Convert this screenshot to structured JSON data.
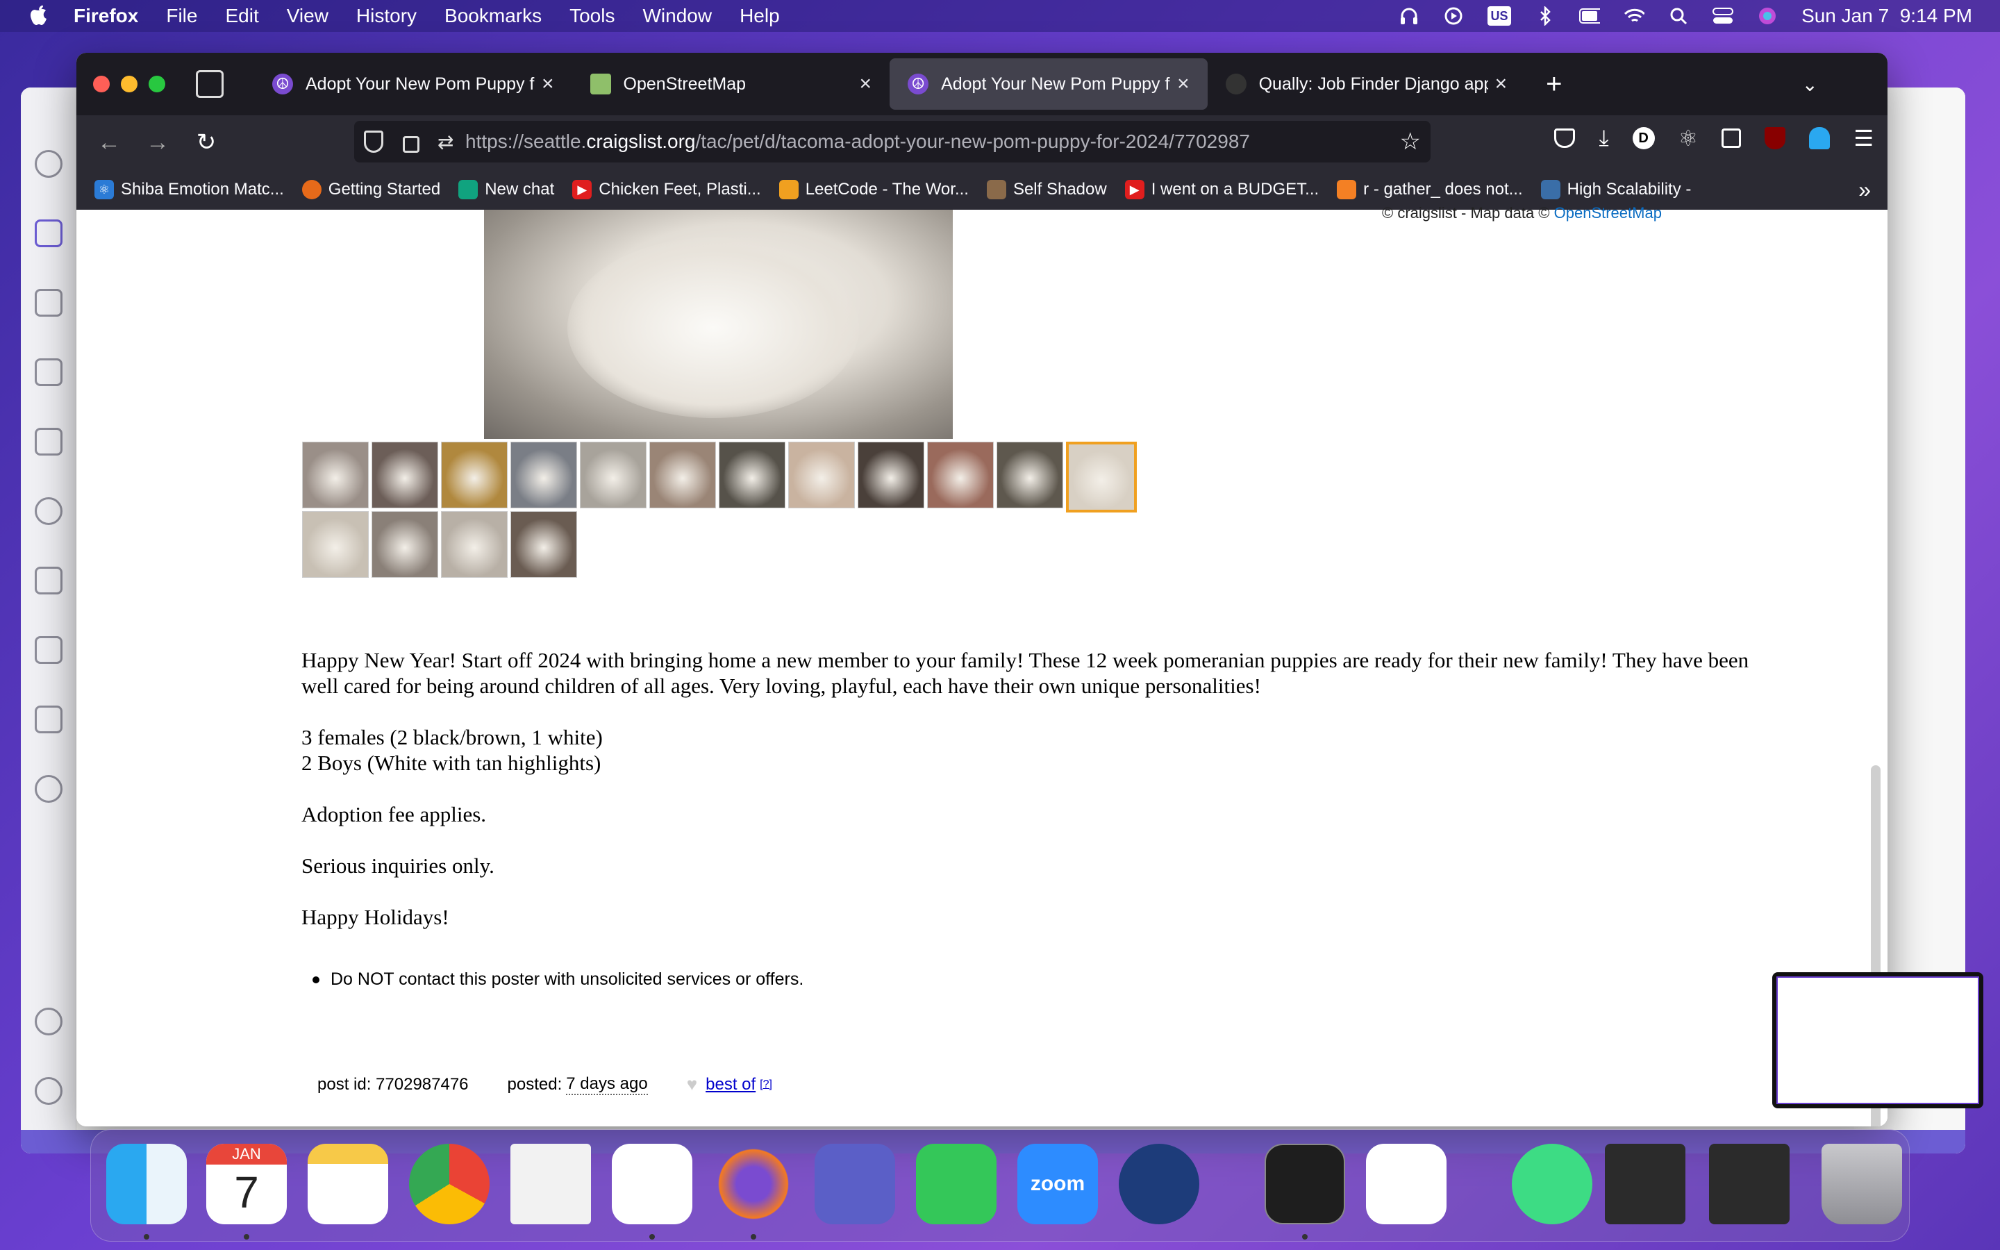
{
  "menubar": {
    "app": "Firefox",
    "items": [
      "File",
      "Edit",
      "View",
      "History",
      "Bookmarks",
      "Tools",
      "Window",
      "Help"
    ],
    "input_source": "US",
    "datetime": "Sun Jan 7  9:14 PM"
  },
  "firefox": {
    "tabs": [
      {
        "title": "Adopt Your New Pom Puppy for",
        "icon": "peace-icon"
      },
      {
        "title": "OpenStreetMap",
        "icon": "map-icon"
      },
      {
        "title": "Adopt Your New Pom Puppy for",
        "icon": "peace-icon",
        "active": true
      },
      {
        "title": "Qually: Job Finder Django app |",
        "icon": "github-icon"
      }
    ],
    "url_prefix": "https://seattle.",
    "url_domain": "craigslist.org",
    "url_path": "/tac/pet/d/tacoma-adopt-your-new-pom-puppy-for-2024/7702987",
    "bookmarks": [
      {
        "label": "Shiba Emotion Matc...",
        "color": "#2b7bd6"
      },
      {
        "label": "Getting Started",
        "color": "#e66a1a"
      },
      {
        "label": "New chat",
        "color": "#10a37f"
      },
      {
        "label": "Chicken Feet, Plasti...",
        "color": "#e01e1e"
      },
      {
        "label": "LeetCode - The Wor...",
        "color": "#f0a020"
      },
      {
        "label": "Self Shadow",
        "color": "#8a6a4a"
      },
      {
        "label": "I went on a BUDGET...",
        "color": "#e01e1e"
      },
      {
        "label": "r - gather_ does not...",
        "color": "#f48024"
      },
      {
        "label": "High Scalability -",
        "color": "#3a6ea8"
      }
    ]
  },
  "posting": {
    "map_credit": "© craigslist - Map data ©",
    "map_link": "OpenStreetMap",
    "paragraphs": [
      "Happy New Year! Start off 2024 with bringing home a new member to your family! These 12 week pomeranian puppies are ready for their new family! They have been well cared for being around children of all ages. Very loving, playful, each have their own unique personalities!",
      "3 females (2 black/brown, 1 white)\n2 Boys (White with tan highlights)",
      "Adoption fee applies.",
      "Serious inquiries only.",
      "Happy Holidays!"
    ],
    "notice": "Do NOT contact this poster with unsolicited services or offers.",
    "post_id_label": "post id: 7702987476",
    "posted_label": "posted:",
    "posted_value": "7 days ago",
    "best_of": "best of",
    "best_of_ref": "[?]",
    "thumbnails_row1": [
      "#9a8f88",
      "#6c5e58",
      "#b0883e",
      "#7a7e86",
      "#a8a39b",
      "#9a8576",
      "#56524a",
      "#c9b3a0",
      "#4a403a",
      "#9a6a5c",
      "#5e584e",
      "#d8d0c4"
    ],
    "thumbnails_row2": [
      "#c8c0b4",
      "#8a8078",
      "#b8b0a6",
      "#6a5c52"
    ],
    "selected_thumbnail": 11
  },
  "dock": {
    "calendar_month": "JAN",
    "calendar_day": "7",
    "zoom_label": "zoom"
  }
}
